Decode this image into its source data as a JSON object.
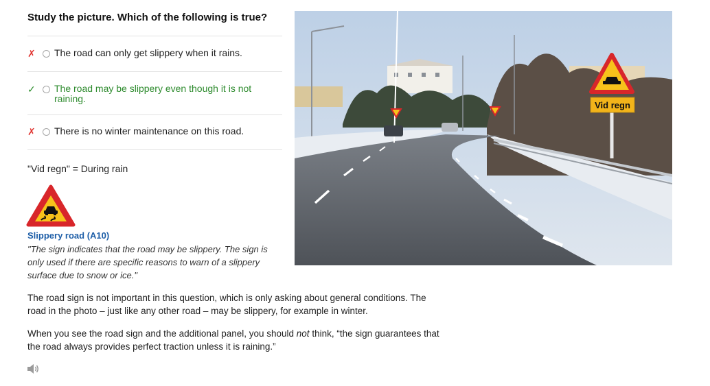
{
  "question": "Study the picture. Which of the following is true?",
  "answers": [
    {
      "mark": "✗",
      "status": "incorrect",
      "text": "The road can only get slippery when it rains."
    },
    {
      "mark": "✓",
      "status": "correct",
      "text": "The road may be slippery even though it is not raining."
    },
    {
      "mark": "✗",
      "status": "incorrect",
      "text": "There is no winter maintenance on this road."
    }
  ],
  "translation": "\"Vid regn\" = During rain",
  "sign": {
    "icon": "slippery-road-sign-icon",
    "title": "Slippery road (A10)",
    "description": "\"The sign indicates that the road may be slippery. The sign is only used if there are specific reasons to warn of a slippery surface due to snow or ice.\""
  },
  "explanation": {
    "p1": "The road sign is not important in this question, which is only asking about general conditions. The road in the photo – just like any other road – may be slippery, for example in winter.",
    "p2_before": "When you see the road sign and the additional panel, you should ",
    "p2_emph": "not",
    "p2_after": " think, “the sign guarantees that the road always provides perfect traction unless it is raining.”"
  },
  "photo": {
    "panel_text": "Vid regn"
  },
  "audio": {
    "icon": "speaker-icon"
  },
  "colors": {
    "incorrect": "#e0332f",
    "correct": "#2e8b2e",
    "sign_title": "#1f5fa8",
    "sign_red": "#d8262a",
    "sign_yellow": "#f7c21b"
  }
}
